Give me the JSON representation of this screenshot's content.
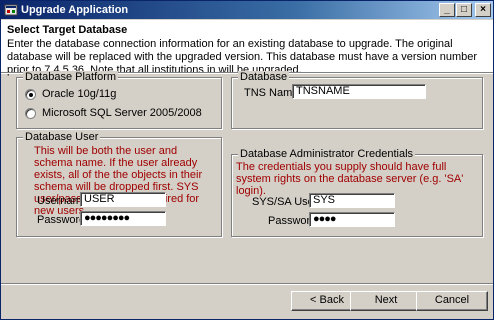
{
  "window": {
    "title": "Upgrade Application",
    "minimize_glyph": "_",
    "maximize_glyph": "□",
    "close_glyph": "×"
  },
  "header": {
    "title": "Select Target Database",
    "description": "Enter the database connection information for an existing database to upgrade.  The original database will be replaced with the upgraded version.  This database must have a version number prior to 7.4.5.36.  Note that all institutions in will be upgraded."
  },
  "platform": {
    "legend": "Database Platform",
    "options": [
      {
        "label": "Oracle 10g/11g",
        "selected": true
      },
      {
        "label": "Microsoft SQL Server 2005/2008",
        "selected": false
      }
    ]
  },
  "database": {
    "legend": "Database",
    "tns_label": "TNS Name",
    "tns_value": "TNSNAME"
  },
  "db_user": {
    "legend": "Database User",
    "note": "This will be both the user and schema name. If the user already exists, all of the the objects in their schema will be dropped first. SYS user/password is only required for new users.",
    "username_label": "Username",
    "username_value": "USER",
    "password_label": "Password",
    "password_value": "●●●●●●●●"
  },
  "admin": {
    "legend": "Database Administrator Credentials",
    "note": "The credentials you supply should have full system rights on the database server (e.g. 'SA' login).",
    "user_label": "SYS/SA User",
    "user_value": "SYS",
    "password_label": "Password",
    "password_value": "●●●●"
  },
  "buttons": {
    "back": "< Back",
    "next": "Next",
    "cancel": "Cancel"
  },
  "colors": {
    "titlebar": "#0a246a",
    "note_text": "#a00000",
    "face": "#d4d0c8"
  }
}
